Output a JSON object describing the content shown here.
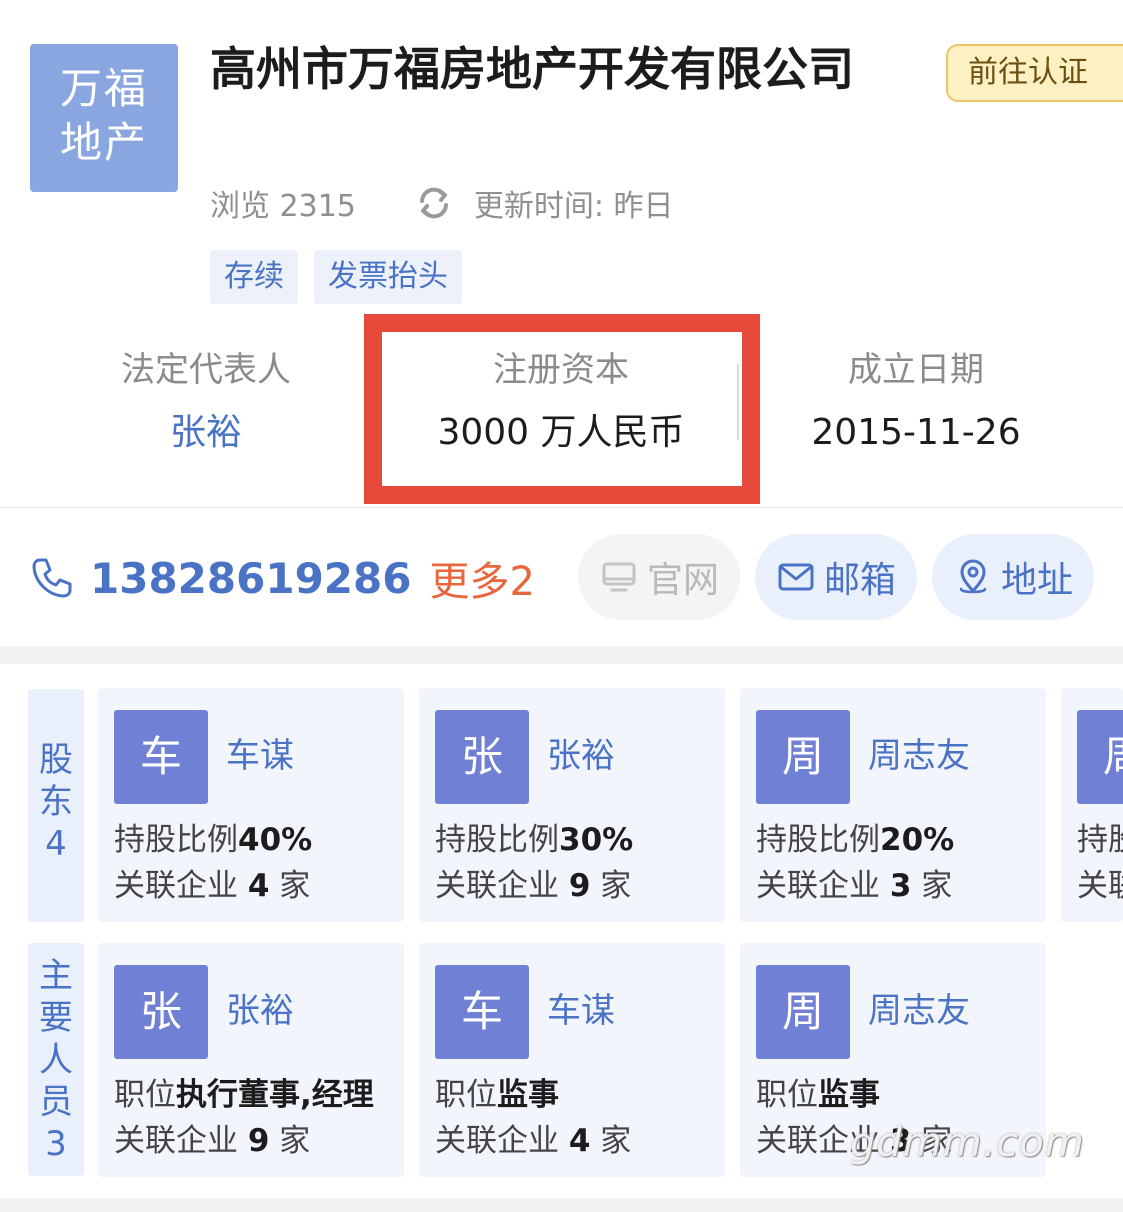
{
  "company": {
    "logo_line1": "万福",
    "logo_line2": "地产",
    "name": "高州市万福房地产开发有限公司",
    "verify_label": "前往认证",
    "views": "浏览 2315",
    "update_label": "更新时间: 昨日",
    "tags": [
      "存续",
      "发票抬头"
    ]
  },
  "info": {
    "legal_rep_label": "法定代表人",
    "legal_rep_value": "张裕",
    "capital_label": "注册资本",
    "capital_value": "3000 万人民币",
    "founded_label": "成立日期",
    "founded_value": "2015-11-26"
  },
  "contact": {
    "phone": "13828619286",
    "more": "更多2",
    "website_label": "官网",
    "email_label": "邮箱",
    "address_label": "地址"
  },
  "shareholders": {
    "label": [
      "股",
      "东",
      "4"
    ],
    "items": [
      {
        "avatar": "车",
        "name": "车谋",
        "ratio_label": "持股比例",
        "ratio": "40%",
        "related_label": "关联企业",
        "related_count": "4",
        "unit": "家"
      },
      {
        "avatar": "张",
        "name": "张裕",
        "ratio_label": "持股比例",
        "ratio": "30%",
        "related_label": "关联企业",
        "related_count": "9",
        "unit": "家"
      },
      {
        "avatar": "周",
        "name": "周志友",
        "ratio_label": "持股比例",
        "ratio": "20%",
        "related_label": "关联企业",
        "related_count": "3",
        "unit": "家"
      },
      {
        "avatar": "周",
        "line1_partial": "持股",
        "line2_partial": "关联"
      }
    ]
  },
  "staff": {
    "label": [
      "主",
      "要",
      "人",
      "员",
      "3"
    ],
    "items": [
      {
        "avatar": "张",
        "name": "张裕",
        "position_label": "职位",
        "position": "执行董事,经理",
        "related_label": "关联企业",
        "related_count": "9",
        "unit": "家"
      },
      {
        "avatar": "车",
        "name": "车谋",
        "position_label": "职位",
        "position": "监事",
        "related_label": "关联企业",
        "related_count": "4",
        "unit": "家"
      },
      {
        "avatar": "周",
        "name": "周志友",
        "position_label": "职位",
        "position": "监事",
        "related_label": "关联企业",
        "related_count": "3",
        "unit": "家"
      }
    ]
  },
  "watermark": "gdmm.com",
  "colors": {
    "accent_blue": "#4a73c6",
    "avatar_bg": "#7080d4",
    "logo_bg": "#8aa6e0",
    "highlight_red": "#e64a3a",
    "more_orange": "#e8663c",
    "verify_bg": "#fdf1c4"
  },
  "icons": {
    "refresh": "refresh-icon",
    "phone": "phone-icon",
    "website": "monitor-icon",
    "email": "mail-icon",
    "address": "location-pin-icon"
  }
}
